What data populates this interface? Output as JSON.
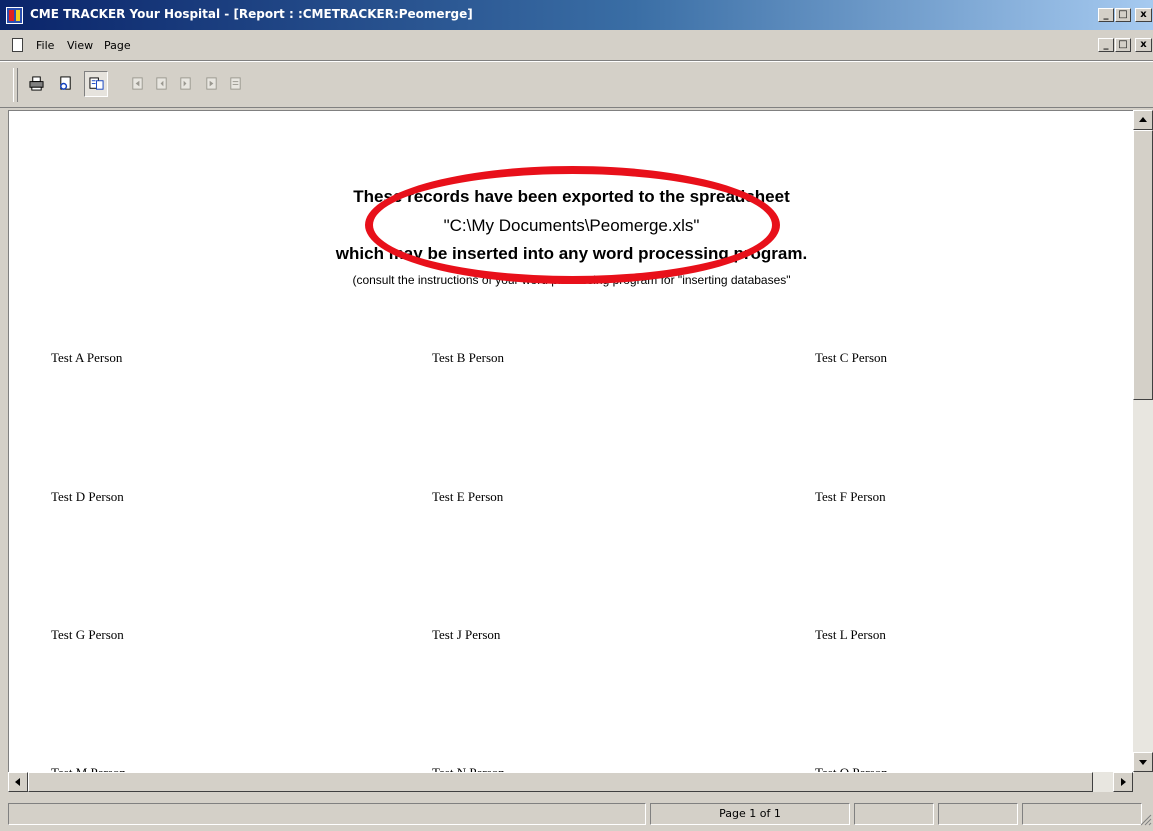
{
  "window": {
    "title": "CME TRACKER  Your Hospital - [Report : :CMETRACKER:Peomerge]",
    "controls": {
      "minimize": "_",
      "maximize": "□",
      "close": "x"
    }
  },
  "menu": {
    "items": [
      "File",
      "View",
      "Page"
    ]
  },
  "toolbar": {
    "buttons": [
      "print-icon",
      "page-setup-icon",
      "zoom-icon",
      "first-page-icon",
      "previous-page-icon",
      "next-page-icon",
      "last-page-icon",
      "close-preview-icon"
    ]
  },
  "report": {
    "line1": "These records have been exported to the spreadsheet",
    "line2": "\"C:\\My Documents\\Peomerge.xls\"",
    "line3": "which may be inserted into any word processing program.",
    "line4": "(consult the instructions of your word processing program for \"inserting databases\"",
    "people": [
      "Test A Person",
      "Test B Person",
      "Test C Person",
      "Test D Person",
      "Test E Person",
      "Test F Person",
      "Test G Person",
      "Test J Person",
      "Test L Person",
      "Test M Person",
      "Test N Person",
      "Test O Person"
    ],
    "highlight_color": "#e8101a"
  },
  "status": {
    "page": "Page 1 of 1"
  }
}
